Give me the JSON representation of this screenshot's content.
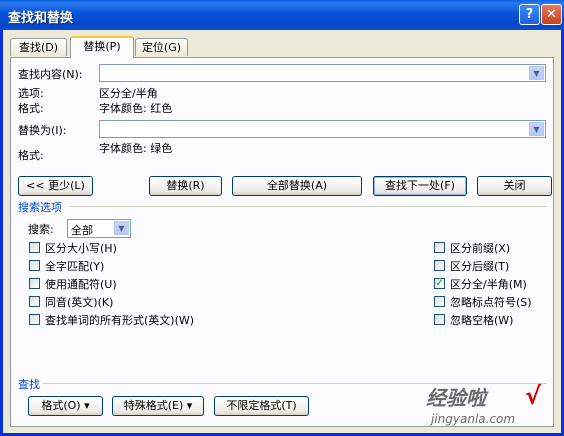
{
  "window": {
    "title": "查找和替换"
  },
  "tabs": [
    {
      "label": "查找(D)"
    },
    {
      "label": "替换(P)"
    },
    {
      "label": "定位(G)"
    }
  ],
  "find": {
    "label": "查找内容(N):",
    "value": "",
    "options_label": "选项:",
    "options_value": "区分全/半角",
    "format_label": "格式:",
    "format_value": "字体颜色: 红色"
  },
  "replace": {
    "label": "替换为(I):",
    "value": "",
    "format_label": "格式:",
    "format_value": "字体颜色: 绿色"
  },
  "buttons": {
    "less": "<< 更少(L)",
    "replace": "替换(R)",
    "replace_all": "全部替换(A)",
    "find_next": "查找下一处(F)",
    "close": "关闭"
  },
  "search_options": {
    "title": "搜索选项",
    "search_label": "搜索:",
    "search_value": "全部",
    "left": [
      {
        "label": "区分大小写(H)",
        "checked": false
      },
      {
        "label": "全字匹配(Y)",
        "checked": false
      },
      {
        "label": "使用通配符(U)",
        "checked": false
      },
      {
        "label": "同音(英文)(K)",
        "checked": false
      },
      {
        "label": "查找单词的所有形式(英文)(W)",
        "checked": false
      }
    ],
    "right": [
      {
        "label": "区分前缀(X)",
        "checked": false
      },
      {
        "label": "区分后缀(T)",
        "checked": false
      },
      {
        "label": "区分全/半角(M)",
        "checked": true
      },
      {
        "label": "忽略标点符号(S)",
        "checked": false
      },
      {
        "label": "忽略空格(W)",
        "checked": false
      }
    ]
  },
  "find_section": {
    "title": "查找",
    "format_button": "格式(O) ▾",
    "special_button": "特殊格式(E) ▾",
    "no_format_button": "不限定格式(T)"
  },
  "watermark": {
    "text": "经验啦",
    "sub": "jingyanla.com",
    "mark": "√"
  }
}
